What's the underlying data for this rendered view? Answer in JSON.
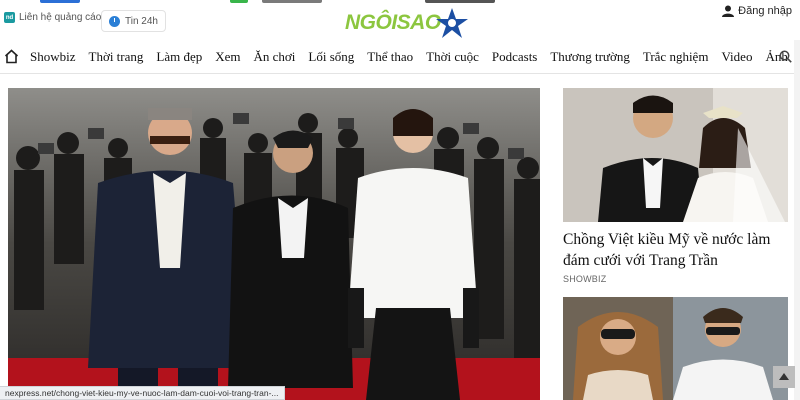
{
  "header": {
    "ad_link": "Liên hệ quảng cáo",
    "ad_icon_text": "nd",
    "news24": "Tin 24h",
    "logo": "NGÔISAO",
    "login": "Đăng nhập"
  },
  "nav": {
    "items": [
      "Showbiz",
      "Thời trang",
      "Làm đẹp",
      "Xem",
      "Ăn chơi",
      "Lối sống",
      "Thể thao",
      "Thời cuộc",
      "Podcasts",
      "Thương trường",
      "Trắc nghiệm",
      "Video",
      "Ảnh"
    ]
  },
  "side": {
    "title": "Chồng Việt kiều Mỹ về nước làm đám cưới với Trang Trần",
    "tag": "SHOWBIZ"
  },
  "status": {
    "url": "nexpress.net/chong-viet-kieu-my-ve-nuoc-lam-dam-cuoi-voi-trang-tran-..."
  },
  "icons": [
    "home-icon",
    "search-icon",
    "person-icon",
    "clock-icon",
    "star-icon",
    "arrow-up-icon"
  ],
  "colors": {
    "logo_green": "#8cc63f",
    "logo_star": "#1c4fa3",
    "carpet": "#b3121c"
  }
}
